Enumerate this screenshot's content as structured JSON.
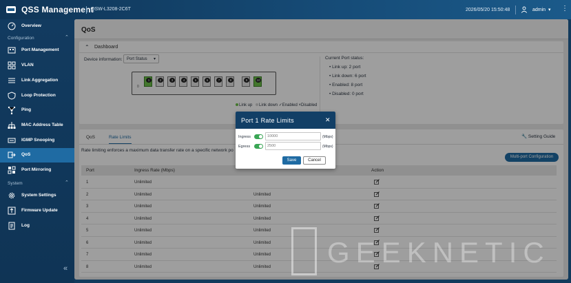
{
  "header": {
    "app_title": "QSS  Management",
    "model": "QSW-L3208-2C6T",
    "datetime": "2026/05/20  15:50:48",
    "user": "admin"
  },
  "sidebar": {
    "sections": {
      "configuration": "Configuration",
      "system": "System"
    },
    "items": [
      {
        "label": "Overview",
        "icon": "overview-icon"
      },
      {
        "label": "Port Management",
        "icon": "port-management-icon"
      },
      {
        "label": "VLAN",
        "icon": "vlan-icon"
      },
      {
        "label": "Link Aggregation",
        "icon": "link-aggregation-icon"
      },
      {
        "label": "Loop Protection",
        "icon": "shield-icon"
      },
      {
        "label": "Ping",
        "icon": "ping-icon"
      },
      {
        "label": "MAC Address Table",
        "icon": "mac-table-icon"
      },
      {
        "label": "IGMP Snooping",
        "icon": "igmp-icon"
      },
      {
        "label": "QoS",
        "icon": "qos-icon",
        "active": true
      },
      {
        "label": "Port Mirroring",
        "icon": "mirror-icon"
      },
      {
        "label": "System Settings",
        "icon": "gear-icon"
      },
      {
        "label": "Firmware Update",
        "icon": "firmware-icon"
      },
      {
        "label": "Log",
        "icon": "log-icon"
      }
    ]
  },
  "page": {
    "title": "QoS",
    "dashboard": {
      "title": "Dashboard",
      "device_info_label": "Device information:",
      "device_select_value": "Port Status",
      "switch_row_label": "0",
      "ports": [
        {
          "num": "1",
          "up": true
        },
        {
          "num": "2",
          "up": false
        },
        {
          "num": "3",
          "up": false
        },
        {
          "num": "4",
          "up": false
        },
        {
          "num": "5",
          "up": false
        },
        {
          "num": "6",
          "up": false
        },
        {
          "num": "7",
          "up": false
        },
        {
          "num": "8",
          "up": false
        },
        {
          "num": "9",
          "up": false
        },
        {
          "num": "10",
          "up": true
        }
      ],
      "legend": {
        "link_up": "Link up",
        "link_down": "Link down",
        "enabled": "Enabled",
        "disabled": "Disabled"
      },
      "status_title": "Current Port status:",
      "status": {
        "link_up": "Link up:   2  port",
        "link_down": "Link down:   6  port",
        "enabled": "Enabled:   8  port",
        "disabled": "Disabled:   0  port"
      }
    },
    "tabs": [
      "QoS",
      "Rate Limits"
    ],
    "active_tab": "Rate Limits",
    "setting_guide": "Setting  Guide",
    "description": "Rate limiting enforces a maximum data transfer rate on a specific network po",
    "multi_port_button": "Multi-port  Configuration",
    "table": {
      "headers": [
        "Port",
        "Ingress  Rate  (Mbps)",
        "Action"
      ],
      "rows": [
        {
          "port": "1",
          "ingress": "Unlimited",
          "egress": ""
        },
        {
          "port": "2",
          "ingress": "Unlimited",
          "egress": "Unlimited"
        },
        {
          "port": "3",
          "ingress": "Unlimited",
          "egress": "Unlimited"
        },
        {
          "port": "4",
          "ingress": "Unlimited",
          "egress": "Unlimited"
        },
        {
          "port": "5",
          "ingress": "Unlimited",
          "egress": "Unlimited"
        },
        {
          "port": "6",
          "ingress": "Unlimited",
          "egress": "Unlimited"
        },
        {
          "port": "7",
          "ingress": "Unlimited",
          "egress": "Unlimited"
        },
        {
          "port": "8",
          "ingress": "Unlimited",
          "egress": "Unlimited"
        }
      ]
    }
  },
  "modal": {
    "title": "Port  1  Rate  Limits",
    "ingress_label": "Ingress",
    "ingress_placeholder": "10000",
    "egress_label": "Egress",
    "egress_placeholder": "2500",
    "unit": "(Mbps)",
    "save": "Save",
    "cancel": "Cancel"
  },
  "watermark": "GEEKNETIC",
  "colors": {
    "accent": "#1f6ba3",
    "header_bg": "#123f66",
    "toggle_on": "#3aa655",
    "port_up": "#6cc04a"
  }
}
